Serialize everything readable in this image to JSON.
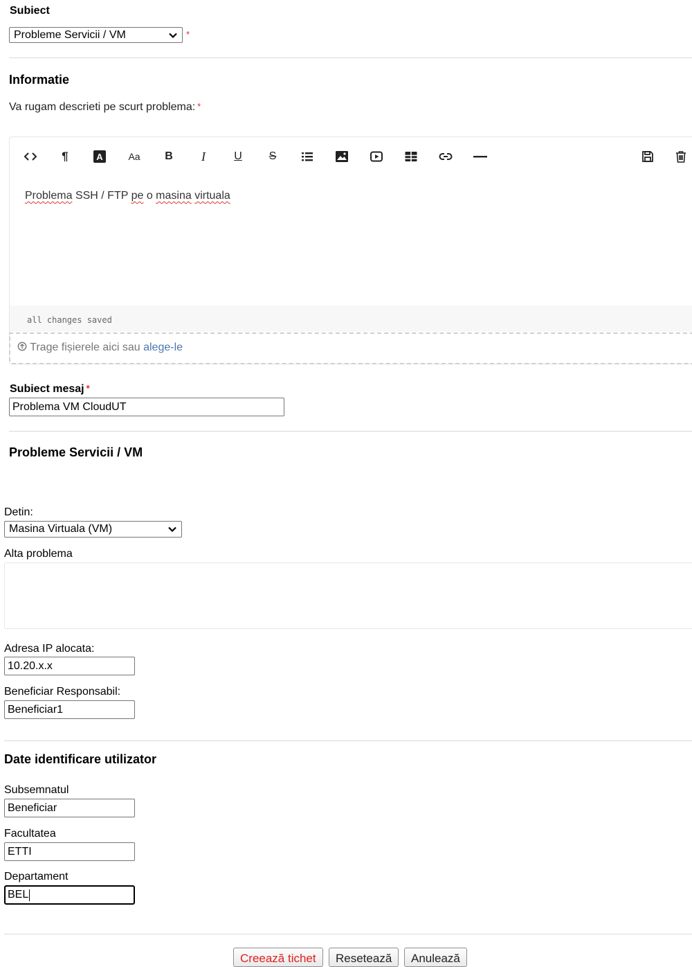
{
  "subject": {
    "label": "Subiect",
    "selected": "Probleme Servicii / VM",
    "required_mark": "*"
  },
  "information": {
    "heading": "Informatie",
    "prompt": "Va rugam descrieti pe scurt problema:",
    "required_mark": "*",
    "editor": {
      "toolbar": [
        "code-view",
        "paragraph",
        "text-color",
        "font-size",
        "bold",
        "italic",
        "underline",
        "strikethrough",
        "list",
        "image",
        "video",
        "table",
        "link",
        "horizontal-rule",
        "save",
        "delete"
      ],
      "toolbar_glyphs": {
        "font_size": "Aa",
        "bold": "B",
        "italic": "I",
        "underline": "U",
        "strike": "S",
        "paragraph": "¶",
        "text_color": "A"
      },
      "content": {
        "w1": "Problema",
        "w2": "SSH / FTP",
        "w3": "pe",
        "w4": "o",
        "w5": "masina",
        "w6": "virtuala"
      },
      "status": "all changes saved",
      "dropzone_text": "Trage fișierele aici sau",
      "dropzone_link": "alege-le"
    }
  },
  "message_subject": {
    "label": "Subiect mesaj",
    "required_mark": "*",
    "value": "Problema VM CloudUT"
  },
  "services": {
    "heading": "Probleme Servicii / VM",
    "detin_label": "Detin:",
    "detin_selected": "Masina Virtuala (VM)",
    "other_problem_label": "Alta problema",
    "other_problem_value": "",
    "ip_label": "Adresa IP alocata:",
    "ip_value": "10.20.x.x",
    "beneficiary_label": "Beneficiar Responsabil:",
    "beneficiary_value": "Beneficiar1"
  },
  "user_identification": {
    "heading": "Date identificare utilizator",
    "undersigned_label": "Subsemnatul",
    "undersigned_value": "Beneficiar",
    "faculty_label": "Facultatea",
    "faculty_value": "ETTI",
    "department_label": "Departament",
    "department_value": "BEL"
  },
  "actions": {
    "create": "Creează tichet",
    "reset": "Resetează",
    "cancel": "Anulează"
  },
  "colors": {
    "required": "#ee2233",
    "create_text": "#e02020",
    "link": "#4a78b0"
  }
}
